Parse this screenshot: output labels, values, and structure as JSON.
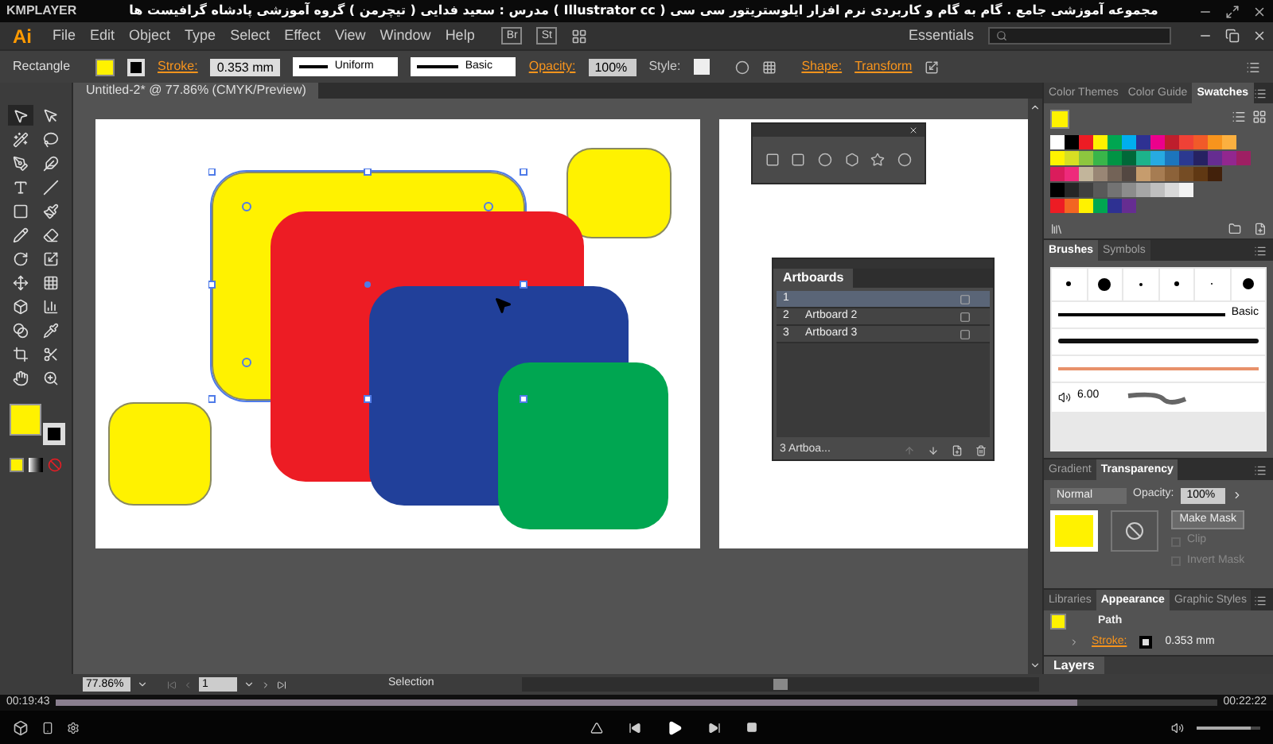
{
  "player": {
    "app_name": "KMPLAYER",
    "title": "مجموعه آموزشی جامع . گام به گام و کاربردی نرم افزار ایلوستریتور سی سی ( Illustrator cc )  مدرس : سعید فدایی ( تیچرمن ) گروه آموزشی پادشاه گرافیست ها",
    "elapsed": "00:19:43",
    "total": "00:22:22",
    "progress": {
      "level": 0.88
    },
    "volume": {
      "level": 0.85
    }
  },
  "menu_bar": {
    "logo": "Ai",
    "items": [
      "File",
      "Edit",
      "Object",
      "Type",
      "Select",
      "Effect",
      "View",
      "Window",
      "Help"
    ],
    "bridge": "Br",
    "stock": "St",
    "workspace": "Essentials"
  },
  "control_bar": {
    "tool_label": "Rectangle",
    "fill": {
      "color": "#fff200"
    },
    "stroke_label": "Stroke:",
    "stroke_weight": "0.353 mm",
    "profile": "Uniform",
    "brush": "Basic",
    "opacity_label": "Opacity:",
    "opacity": "100%",
    "style_label": "Style:",
    "shape_link": "Shape:",
    "transform_link": "Transform"
  },
  "document_tab": {
    "title": "Untitled-2* @ 77.86% (CMYK/Preview)"
  },
  "tools": [
    {
      "selected": true
    },
    {
      "selected": false
    },
    {
      "selected": false
    },
    {
      "selected": false
    },
    {
      "selected": false
    },
    {
      "selected": false
    },
    {
      "selected": false
    },
    {
      "selected": false
    },
    {
      "selected": false
    },
    {
      "selected": false
    },
    {
      "selected": false
    },
    {
      "selected": false
    },
    {
      "selected": false
    },
    {
      "selected": false
    },
    {
      "selected": false
    },
    {
      "selected": false
    },
    {
      "selected": false
    },
    {
      "selected": false
    },
    {
      "selected": false
    },
    {
      "selected": false
    },
    {
      "selected": false
    },
    {
      "selected": false
    },
    {
      "selected": false
    },
    {
      "selected": false
    }
  ],
  "tools_fill": {
    "color": "#fff200"
  },
  "shapes": [
    {
      "color": "#fff200",
      "selected": true
    },
    {
      "color": "#ed1c24",
      "selected": false
    },
    {
      "color": "#21409a",
      "selected": false
    },
    {
      "color": "#00a651",
      "selected": false
    },
    {
      "color": "#fff200",
      "selected": false
    },
    {
      "color": "#fff200",
      "selected": false
    }
  ],
  "artboards_panel": {
    "title": "Artboards",
    "rows": [
      {
        "number": "1",
        "selected": true
      },
      {
        "number": "2",
        "name": "Artboard 2",
        "selected": false
      },
      {
        "number": "3",
        "name": "Artboard 3",
        "selected": false
      }
    ],
    "footer": "3 Artboa..."
  },
  "swatches_panel": {
    "tabs": [
      {
        "label": "Color Themes",
        "selected": false
      },
      {
        "label": "Color Guide",
        "selected": false
      },
      {
        "label": "Swatches",
        "selected": true
      }
    ],
    "fill": {
      "color": "#fff200"
    },
    "rows": [
      {
        "swatches": [
          {
            "color": "#ffffff"
          },
          {
            "color": "#000000"
          },
          {
            "color": "#ed1c24"
          },
          {
            "color": "#fff200"
          },
          {
            "color": "#00a651"
          },
          {
            "color": "#00aeef"
          },
          {
            "color": "#2e3192"
          },
          {
            "color": "#ec008c"
          },
          {
            "color": "#be1e2d"
          },
          {
            "color": "#ef4136"
          },
          {
            "color": "#f15a29"
          },
          {
            "color": "#f7941d"
          },
          {
            "color": "#fbb040"
          }
        ]
      },
      {
        "swatches": [
          {
            "color": "#fff200"
          },
          {
            "color": "#d7df23"
          },
          {
            "color": "#8dc63f"
          },
          {
            "color": "#39b54a"
          },
          {
            "color": "#009444"
          },
          {
            "color": "#006838"
          },
          {
            "color": "#1cb38b"
          },
          {
            "color": "#27aae1"
          },
          {
            "color": "#1c75bc"
          },
          {
            "color": "#2b3990"
          },
          {
            "color": "#262262"
          },
          {
            "color": "#662d91"
          },
          {
            "color": "#92278f"
          },
          {
            "color": "#9e1f63"
          }
        ]
      },
      {
        "swatches": [
          {
            "color": "#da1c5c"
          },
          {
            "color": "#ee2a7b"
          },
          {
            "color": "#c2b59b"
          },
          {
            "color": "#998675"
          },
          {
            "color": "#736357"
          },
          {
            "color": "#534741"
          },
          {
            "color": "#c69c6d"
          },
          {
            "color": "#a67c52"
          },
          {
            "color": "#8c6239"
          },
          {
            "color": "#754c24"
          },
          {
            "color": "#603813"
          },
          {
            "color": "#42210b"
          }
        ]
      },
      {
        "swatches": [
          {
            "color": "#000000"
          },
          {
            "color": "#262626"
          },
          {
            "color": "#404040"
          },
          {
            "color": "#595959"
          },
          {
            "color": "#737373"
          },
          {
            "color": "#8c8c8c"
          },
          {
            "color": "#a6a6a6"
          },
          {
            "color": "#bfbfbf"
          },
          {
            "color": "#d9d9d9"
          },
          {
            "color": "#f2f2f2"
          }
        ]
      },
      {
        "swatches": [
          {
            "color": "#ed1c24"
          },
          {
            "color": "#f26522"
          },
          {
            "color": "#fff200"
          },
          {
            "color": "#00a651"
          },
          {
            "color": "#2e3192"
          },
          {
            "color": "#662d91"
          }
        ]
      }
    ]
  },
  "brushes_panel": {
    "tabs": [
      {
        "label": "Brushes",
        "selected": true
      },
      {
        "label": "Symbols",
        "selected": false
      }
    ],
    "basic_label": "Basic",
    "size_reading": "6.00"
  },
  "transparency_panel": {
    "tabs": [
      {
        "label": "Gradient",
        "selected": false
      },
      {
        "label": "Transparency",
        "selected": true
      }
    ],
    "blend_mode": "Normal",
    "opacity_label": "Opacity:",
    "opacity": "100%",
    "thumbnail": {
      "color": "#fff200"
    },
    "make_mask": "Make Mask",
    "options": [
      {
        "label": "Clip",
        "disabled": true
      },
      {
        "label": "Invert Mask",
        "disabled": true
      }
    ]
  },
  "appearance_panel": {
    "tabs": [
      {
        "label": "Libraries",
        "selected": false
      },
      {
        "label": "Appearance",
        "selected": true
      },
      {
        "label": "Graphic Styles",
        "selected": false
      }
    ],
    "item": "Path",
    "item_color": {
      "color": "#fff200"
    },
    "stroke_label": "Stroke:",
    "stroke_weight": "0.353 mm"
  },
  "layers_panel": {
    "title": "Layers"
  },
  "status_bar": {
    "zoom": "77.86%",
    "artboard": "1",
    "tool": "Selection"
  }
}
